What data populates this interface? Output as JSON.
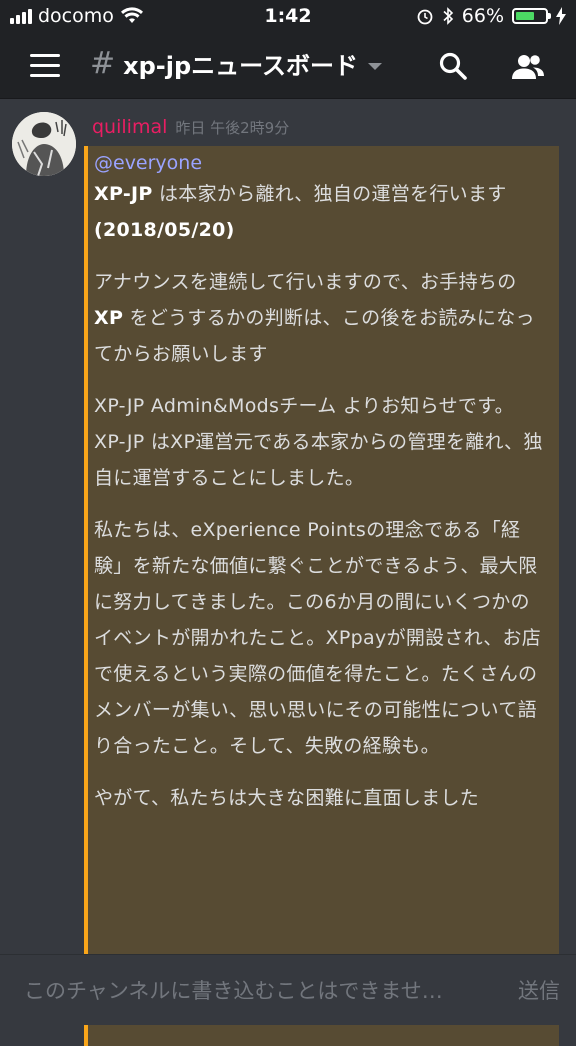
{
  "statusbar": {
    "carrier": "docomo",
    "time": "1:42",
    "battery": "66%",
    "battery_level": 0.66,
    "icons": [
      "signal-icon",
      "wifi-icon",
      "alarm-icon",
      "bluetooth-icon",
      "battery-icon",
      "charging-icon"
    ]
  },
  "header": {
    "channel_name": "xp-jpニュースボード",
    "icons": [
      "menu-icon",
      "hash-icon",
      "search-icon",
      "members-icon"
    ]
  },
  "message": {
    "author": "quilimal",
    "author_color": "#e91e63",
    "timestamp": "昨日 午後2時9分",
    "mention": "@everyone",
    "embed_accent": "#faa61a",
    "embed_bg": "#574b33",
    "para1_bold": "XP-JP",
    "para1_text": " は本家から離れ、独自の運営を行います ",
    "para1_date": "(2018/05/20)",
    "para2_a": "アナウンスを連続して行いますので、お手持ちの ",
    "para2_bold": "XP",
    "para2_b": " をどうするかの判断は、この後をお読みになってからお願いします",
    "para3_line1": "XP-JP Admin&Modsチーム よりお知らせです。",
    "para3_line2": "XP-JP はXP運営元である本家からの管理を離れ、独自に運営することにしました。",
    "para4": "私たちは、eXperience Pointsの理念である「経験」を新たな価値に繋ぐことができるよう、最大限に努力してきました。この6か月の間にいくつかのイベントが開かれたこと。XPpayが開設され、お店で使えるという実際の価値を得たこと。たくさんのメンバーが集い、思い思いにその可能性について語り合ったこと。そして、失敗の経験も。",
    "para5": "やがて、私たちは大きな困難に直面しました"
  },
  "composer": {
    "placeholder": "このチャンネルに書き込むことはできませ…",
    "send_label": "送信"
  }
}
